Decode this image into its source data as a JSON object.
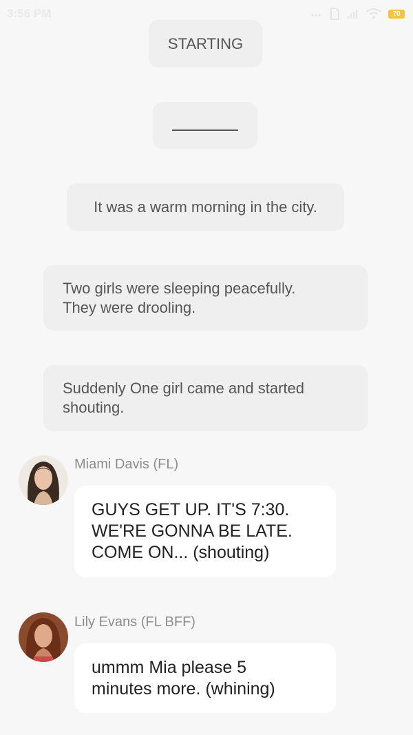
{
  "status_bar": {
    "time": "3:56 PM",
    "battery": "70",
    "icons": [
      "signal-dots-icon",
      "sim-icon",
      "cell-signal-icon",
      "wifi-icon",
      "battery-icon"
    ]
  },
  "narration": [
    {
      "text": "STARTING"
    },
    {
      "text": ""
    },
    {
      "text": "It was a warm morning in the city."
    },
    {
      "line1": "Two girls were sleeping peacefully.",
      "line2": "They were drooling."
    },
    {
      "line1": "Suddenly One girl came and started",
      "line2": "shouting."
    }
  ],
  "messages": [
    {
      "sender": "Miami Davis (FL)",
      "lines": [
        "GUYS GET UP. IT'S 7:30.",
        "WE'RE GONNA BE LATE.",
        "COME ON... (shouting)"
      ]
    },
    {
      "sender": "Lily Evans (FL BFF)",
      "lines": [
        "ummm Mia please 5",
        "minutes more. (whining)"
      ]
    }
  ],
  "colors": {
    "background": "#f7f7f7",
    "narration_bg": "#efefef",
    "bubble_bg": "#ffffff",
    "battery": "#f4c542"
  }
}
